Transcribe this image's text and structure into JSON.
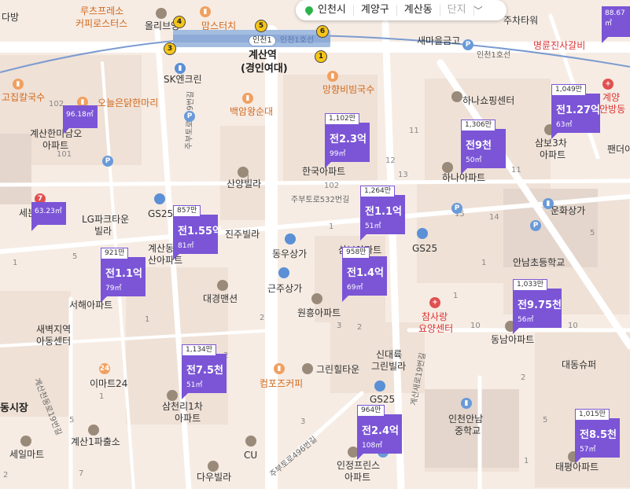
{
  "region": {
    "city": "인천시",
    "district": "계양구",
    "dong": "계산동",
    "complex_placeholder": "단지"
  },
  "station": {
    "name": "계산역",
    "sub": "(경인여대)",
    "line_label": "인천1",
    "line_name": "인천1호선",
    "line_right": "인천1호선"
  },
  "exits": [
    "1",
    "3",
    "4",
    "5",
    "6"
  ],
  "places": [
    "다방",
    "루츠프레소",
    "커피로스터스",
    "올리브영",
    "맘스터치",
    "새마을금고",
    "주차타워",
    "명륜진사갈비",
    "SK엔크린",
    "고집칼국수",
    "오늘은닭한마리",
    "망향비빔국수",
    "백암왕순대",
    "하나쇼핑센터",
    "계산한미남오",
    "아파트",
    "한국아파트",
    "하나아파트",
    "삼보3차",
    "아파트",
    "팬더아",
    "산양빌라",
    "LG파크타운",
    "빌라",
    "세븐",
    "GS25",
    "주부토로532번길",
    "주부토로529번길",
    "운화상가",
    "진주빌라",
    "동우상가",
    "계산동",
    "산아파트",
    "삼보아파트",
    "GS25",
    "안남초등학교",
    "서해아파트",
    "근주상가",
    "대경맨션",
    "원흥아파트",
    "참사랑",
    "요양센터",
    "동남아파트",
    "새벽지역",
    "아동센터",
    "대동슈퍼",
    "신대륙",
    "그린빌라",
    "그린힐타운",
    "이마트24",
    "삼천리1차",
    "아파트",
    "컴포즈커피",
    "GS25",
    "동시장",
    "인천안남",
    "중학교",
    "계산천동로19번길",
    "계산1파출소",
    "세일마트",
    "CU",
    "인정프린스",
    "아파트",
    "다우빌라",
    "주부토로496번길",
    "계산새로19번길",
    "태평아파트",
    "계양",
    "안방동",
    "인천1호선"
  ],
  "lot_numbers": [
    "102",
    "101",
    "101",
    "102",
    "11",
    "12",
    "13",
    "15",
    "14",
    "11",
    "5",
    "1",
    "1",
    "1",
    "1",
    "1",
    "1",
    "10",
    "10",
    "5",
    "2",
    "2",
    "3",
    "3",
    "2",
    "2",
    "5",
    "1",
    "1",
    "5",
    "7",
    "2",
    "2",
    "1"
  ],
  "listings": [
    {
      "count": "1,102만",
      "price": "전2.3억",
      "area": "99㎡"
    },
    {
      "count": "1,306만",
      "price": "전9천",
      "area": "50㎡"
    },
    {
      "count": "1,049만",
      "price": "전1.27억",
      "area": "63㎡"
    },
    {
      "count": "1,264만",
      "price": "전1.1억",
      "area": "51㎡"
    },
    {
      "count": "857만",
      "price": "전1.55억",
      "area": "81㎡"
    },
    {
      "count": "958만",
      "price": "전1.4억",
      "area": "69㎡"
    },
    {
      "count": "921만",
      "price": "전1.1억",
      "area": "79㎡"
    },
    {
      "count": "1,033만",
      "price": "전9.75천",
      "area": "56㎡"
    },
    {
      "count": "1,134만",
      "price": "전7.5천",
      "area": "51㎡"
    },
    {
      "count": "964만",
      "price": "전2.4억",
      "area": "108㎡"
    },
    {
      "count": "1,015만",
      "price": "전8.5천",
      "area": "57㎡"
    }
  ],
  "area_tags": [
    "96.18㎡",
    "63.23㎡",
    "88.67㎡"
  ],
  "colors": {
    "marker": "#7b55d6",
    "land": "#f6ece4",
    "road": "#ffffff",
    "block": "#eedfd3"
  }
}
